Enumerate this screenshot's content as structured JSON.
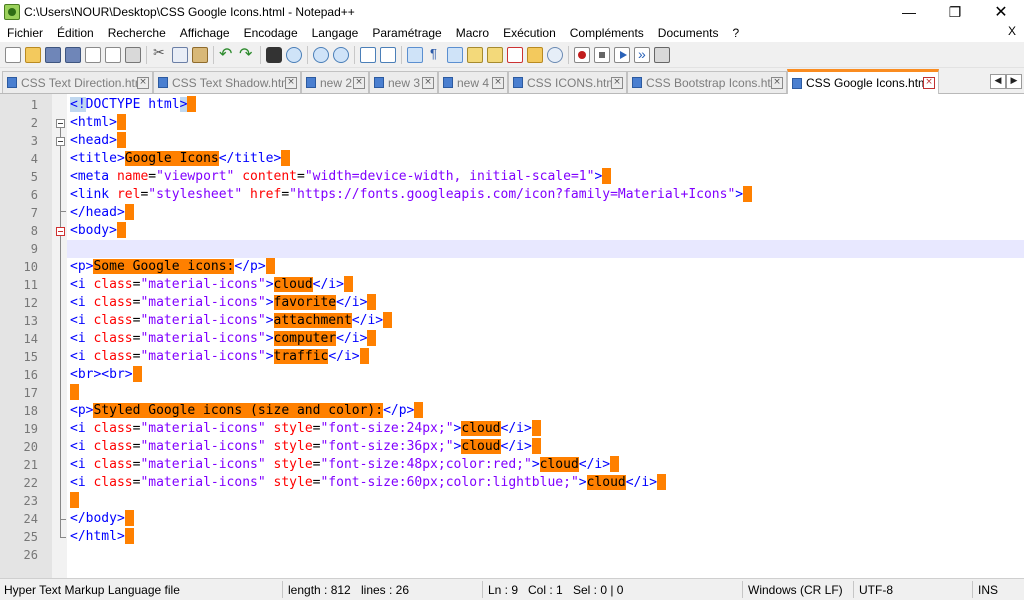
{
  "window": {
    "title": "C:\\Users\\NOUR\\Desktop\\CSS Google Icons.html - Notepad++",
    "minimize": "—",
    "maximize": "❐",
    "close": "✕"
  },
  "menu": {
    "items": [
      "Fichier",
      "Édition",
      "Recherche",
      "Affichage",
      "Encodage",
      "Langage",
      "Paramétrage",
      "Macro",
      "Exécution",
      "Compléments",
      "Documents",
      "?"
    ],
    "close_doc": "X"
  },
  "toolbar": {
    "icons": [
      "new-file-icon",
      "open-file-icon",
      "save-icon",
      "save-all-icon",
      "close-icon",
      "close-all-icon",
      "print-icon",
      "cut-icon",
      "copy-icon",
      "paste-icon",
      "undo-icon",
      "redo-icon",
      "find-icon",
      "replace-icon",
      "zoom-in-icon",
      "zoom-out-icon",
      "sync-vertical-icon",
      "sync-horizontal-icon",
      "word-wrap-icon",
      "show-all-chars-icon",
      "indent-guide-icon",
      "user-language-icon",
      "doc-map-icon",
      "function-list-icon",
      "folder-workspace-icon",
      "monitoring-icon",
      "record-macro-icon",
      "stop-macro-icon",
      "play-macro-icon",
      "run-macro-multiple-icon",
      "save-macro-icon"
    ]
  },
  "tabs": [
    {
      "label": "CSS Text Direction.html",
      "active": false
    },
    {
      "label": "CSS Text Shadow.html",
      "active": false
    },
    {
      "label": "new 2",
      "active": false
    },
    {
      "label": "new 3",
      "active": false
    },
    {
      "label": "new 4",
      "active": false
    },
    {
      "label": "CSS ICONS.html",
      "active": false
    },
    {
      "label": "CSS Bootstrap Icons.html",
      "active": false
    },
    {
      "label": "CSS Google Icons.html",
      "active": true
    }
  ],
  "tab_scroll": {
    "left": "◀",
    "right": "▶"
  },
  "editor": {
    "line_numbers": [
      "1",
      "2",
      "3",
      "4",
      "5",
      "6",
      "7",
      "8",
      "9",
      "10",
      "11",
      "12",
      "13",
      "14",
      "15",
      "16",
      "17",
      "18",
      "19",
      "20",
      "21",
      "22",
      "23",
      "24",
      "25",
      "26"
    ],
    "current_line": 9
  },
  "status": {
    "language": "Hyper Text Markup Language file",
    "length": "length : 812",
    "lines": "lines : 26",
    "ln": "Ln : 9",
    "col": "Col : 1",
    "sel": "Sel : 0 | 0",
    "eol": "Windows (CR LF)",
    "encoding": "UTF-8",
    "mode": "INS"
  },
  "colors": {
    "tag": "#0000ff",
    "attribute": "#ff0000",
    "value": "#8000ff",
    "highlight": "#ff8000",
    "current_line": "#e8e8ff",
    "active_tab_accent": "#fa8c20"
  }
}
